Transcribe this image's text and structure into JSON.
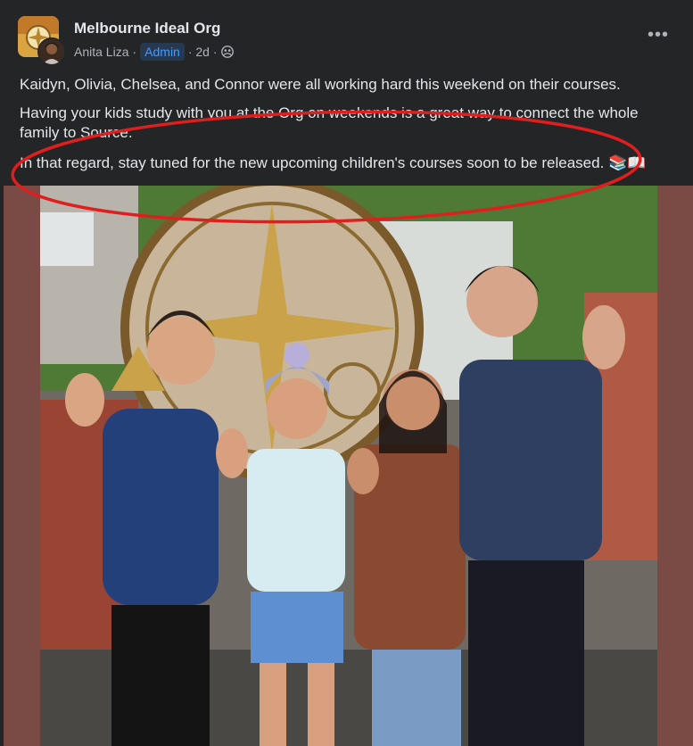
{
  "post": {
    "group_name": "Melbourne Ideal Org",
    "author": "Anita Liza",
    "author_sep": "·",
    "role_badge": "Admin",
    "time": "· 2d ·",
    "more_label": "•••",
    "paragraphs": [
      "Kaidyn, Olivia, Chelsea, and Connor were all working hard this weekend on their courses.",
      "Having your kids study with you at the Org on weekends is a great way to connect the whole family to Source.",
      "In that regard, stay tuned for the new upcoming children's courses soon to be released. 📚📖"
    ]
  },
  "colors": {
    "background": "#242526",
    "text_primary": "#e4e6eb",
    "text_secondary": "#b0b3b8",
    "badge_bg": "#263951",
    "badge_text": "#4599ff",
    "annotation_red": "#e01e1e",
    "photo_frame": "#7a4a44"
  },
  "icons": {
    "privacy": "group-members-icon",
    "more": "more-options-icon"
  }
}
